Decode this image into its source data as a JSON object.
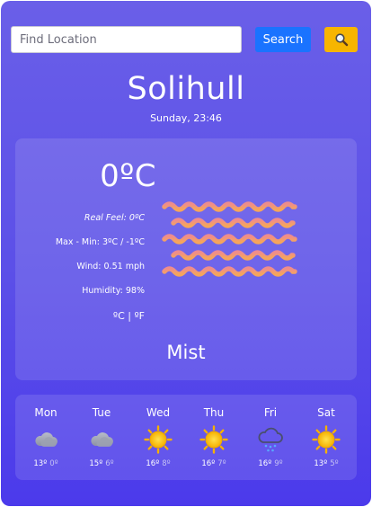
{
  "search": {
    "placeholder": "Find Location",
    "value": "",
    "button_label": "Search"
  },
  "location": {
    "city": "Solihull",
    "datetime": "Sunday, 23:46"
  },
  "current": {
    "temperature": "0ºC",
    "real_feel": "Real Feel: 0ºC",
    "max_min": "Max - Min: 3ºC / -1ºC",
    "wind": "Wind: 0.51 mph",
    "humidity": "Humidity: 98%",
    "unit_celsius": "ºC",
    "unit_separator": " | ",
    "unit_fahrenheit": "ºF",
    "condition": "Mist",
    "icon": "mist-icon"
  },
  "forecast": [
    {
      "day": "Mon",
      "high": "13º",
      "low": "0º",
      "icon": "cloudy-icon"
    },
    {
      "day": "Tue",
      "high": "15º",
      "low": "6º",
      "icon": "cloudy-icon"
    },
    {
      "day": "Wed",
      "high": "16º",
      "low": "8º",
      "icon": "sun-icon"
    },
    {
      "day": "Thu",
      "high": "16º",
      "low": "7º",
      "icon": "sun-icon"
    },
    {
      "day": "Fri",
      "high": "16º",
      "low": "9º",
      "icon": "snow-cloud-icon"
    },
    {
      "day": "Sat",
      "high": "13º",
      "low": "5º",
      "icon": "sun-icon"
    }
  ],
  "colors": {
    "background_top": "#6a5fe8",
    "background_bottom": "#4b3aeb",
    "search_button": "#1a73ff",
    "geo_button": "#f7b500",
    "mist_gradient_start": "#f29a5a",
    "mist_gradient_end": "#d77aa8"
  }
}
